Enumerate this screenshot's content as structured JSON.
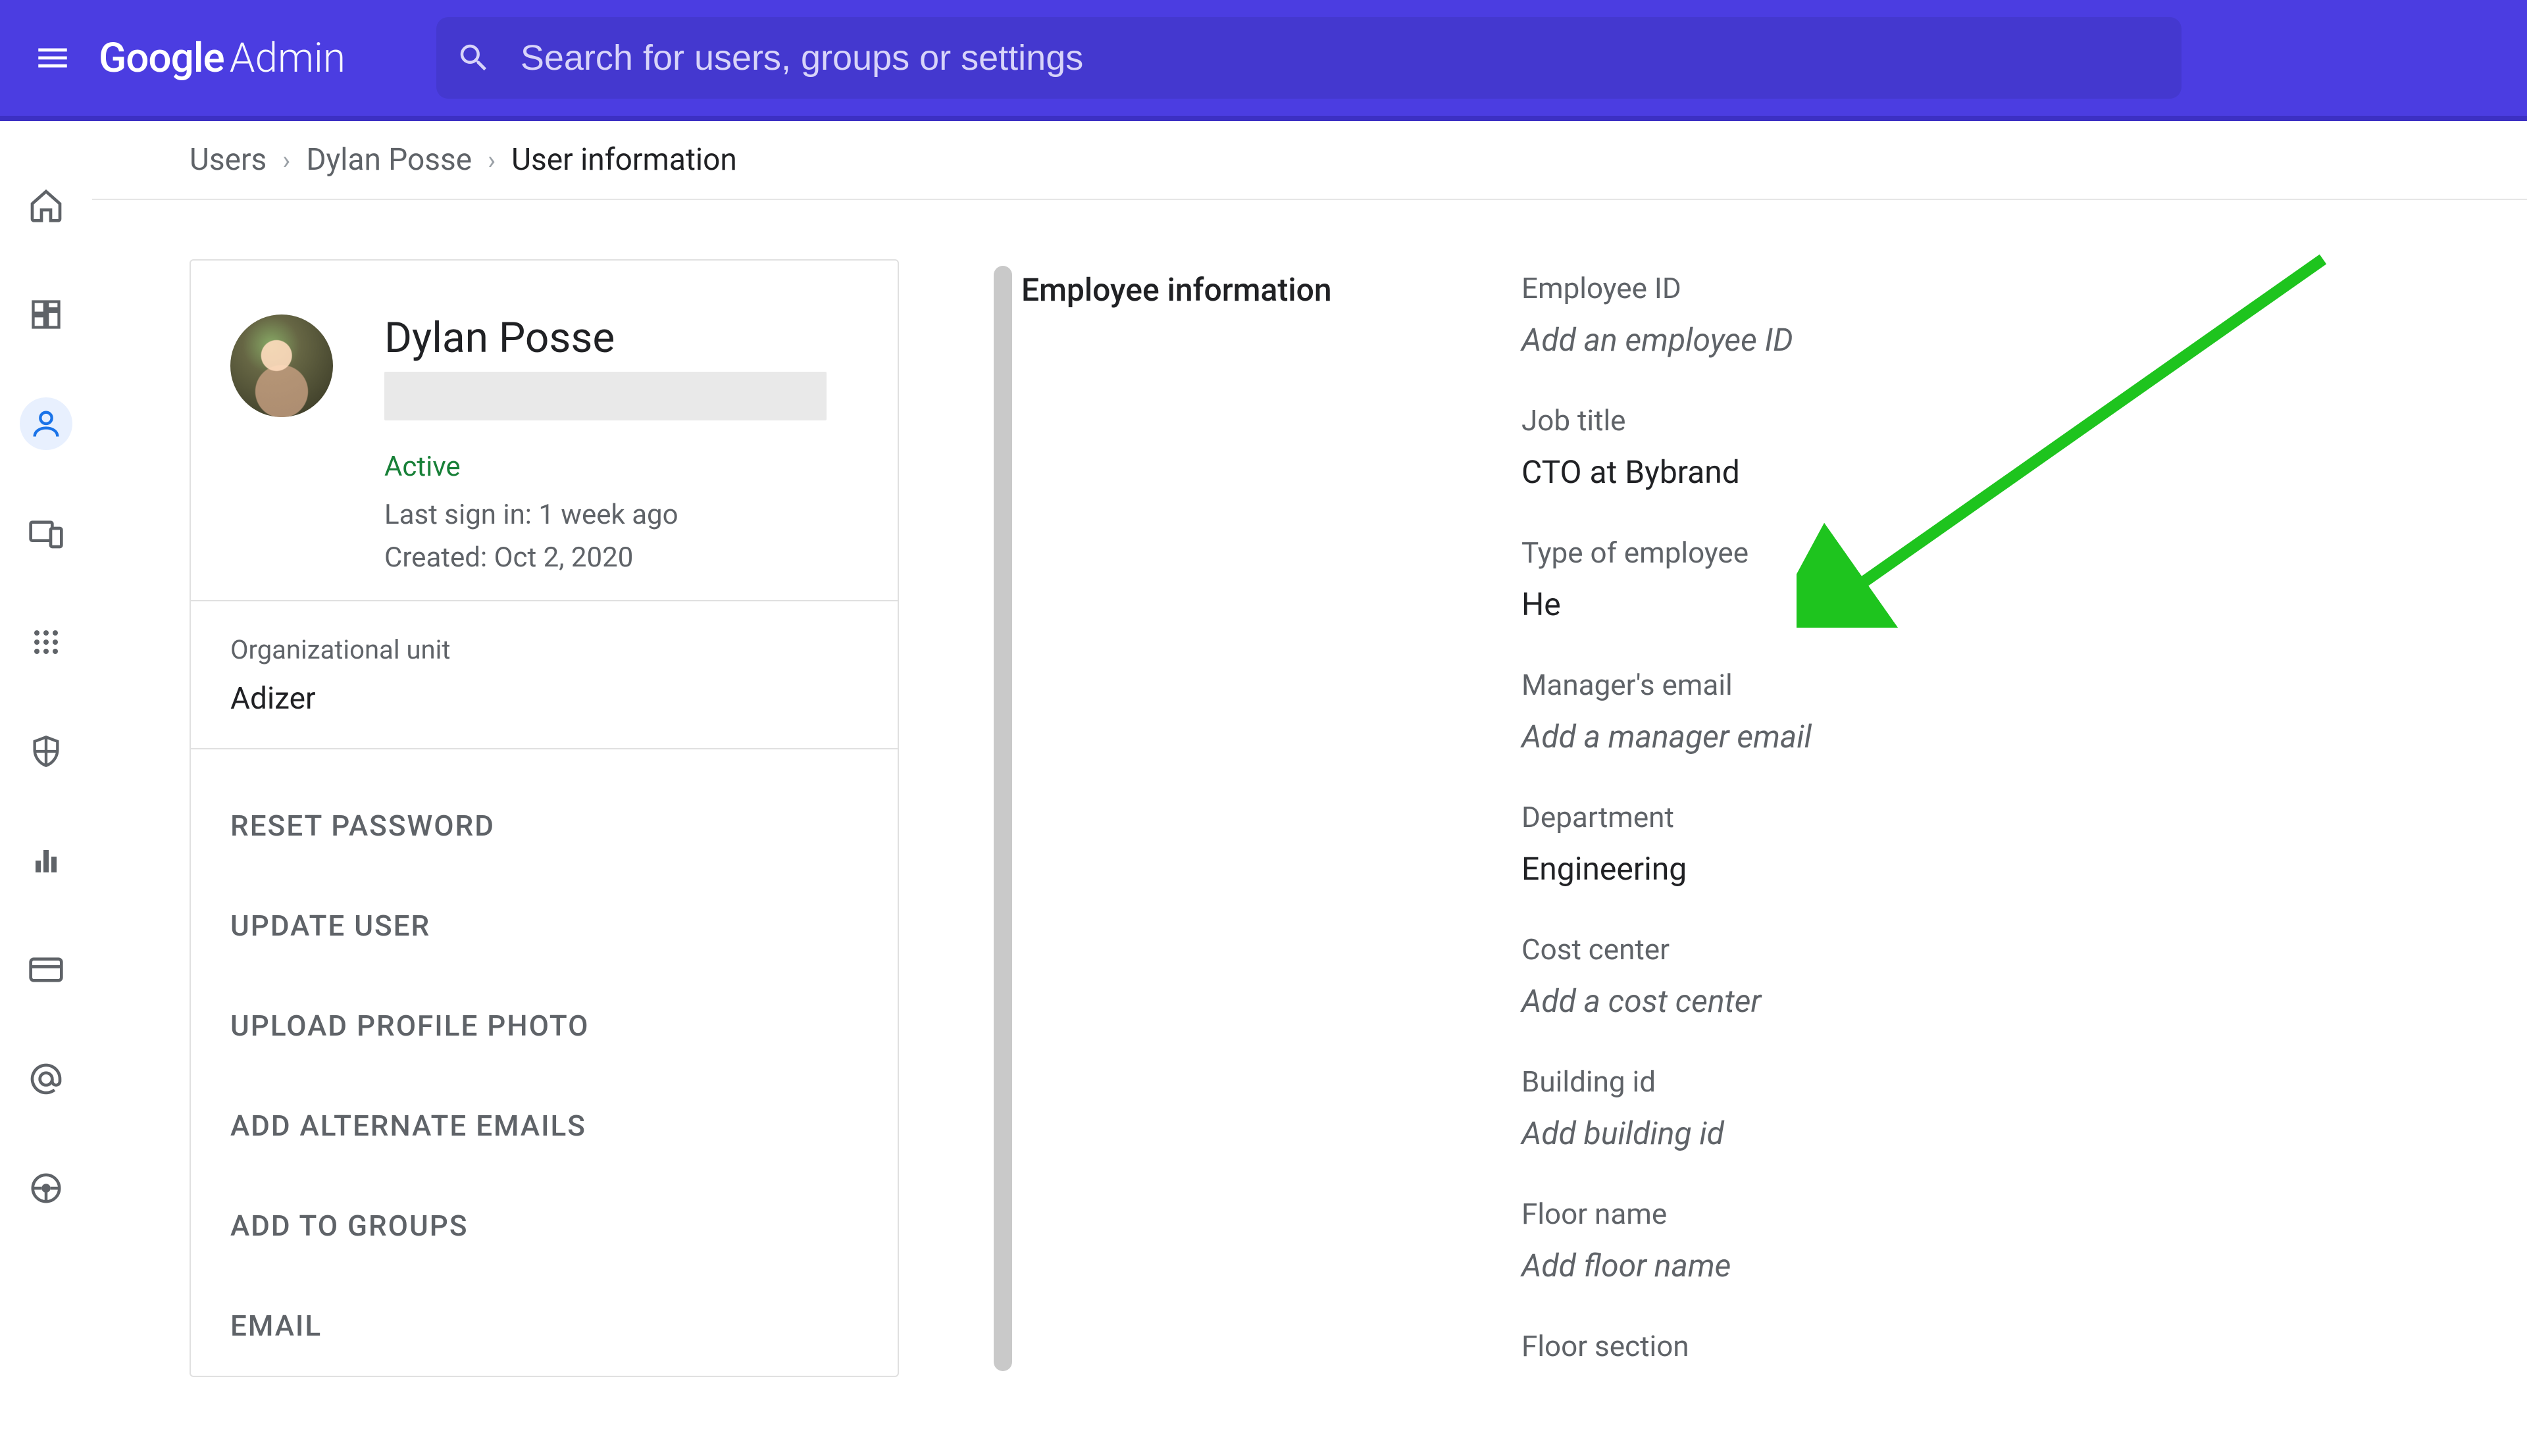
{
  "header": {
    "logo_brand": "Google",
    "logo_product": "Admin",
    "search_placeholder": "Search for users, groups or settings"
  },
  "breadcrumbs": {
    "items": [
      "Users",
      "Dylan Posse",
      "User information"
    ]
  },
  "user_card": {
    "name": "Dylan Posse",
    "status": "Active",
    "last_sign_in": "Last sign in: 1 week ago",
    "created": "Created: Oct 2, 2020",
    "org_unit_label": "Organizational unit",
    "org_unit_value": "Adizer",
    "actions": [
      "RESET PASSWORD",
      "UPDATE USER",
      "UPLOAD PROFILE PHOTO",
      "ADD ALTERNATE EMAILS",
      "ADD TO GROUPS",
      "EMAIL"
    ]
  },
  "detail": {
    "section_title": "Employee information",
    "fields": [
      {
        "label": "Employee ID",
        "value": "",
        "placeholder": "Add an employee ID"
      },
      {
        "label": "Job title",
        "value": "CTO at Bybrand",
        "placeholder": ""
      },
      {
        "label": "Type of employee",
        "value": "He",
        "placeholder": ""
      },
      {
        "label": "Manager's email",
        "value": "",
        "placeholder": "Add a manager email"
      },
      {
        "label": "Department",
        "value": "Engineering",
        "placeholder": ""
      },
      {
        "label": "Cost center",
        "value": "",
        "placeholder": "Add a cost center"
      },
      {
        "label": "Building id",
        "value": "",
        "placeholder": "Add building id"
      },
      {
        "label": "Floor name",
        "value": "",
        "placeholder": "Add floor name"
      },
      {
        "label": "Floor section",
        "value": "",
        "placeholder": ""
      }
    ]
  },
  "annotation": {
    "arrow_color": "#1ec41e"
  }
}
